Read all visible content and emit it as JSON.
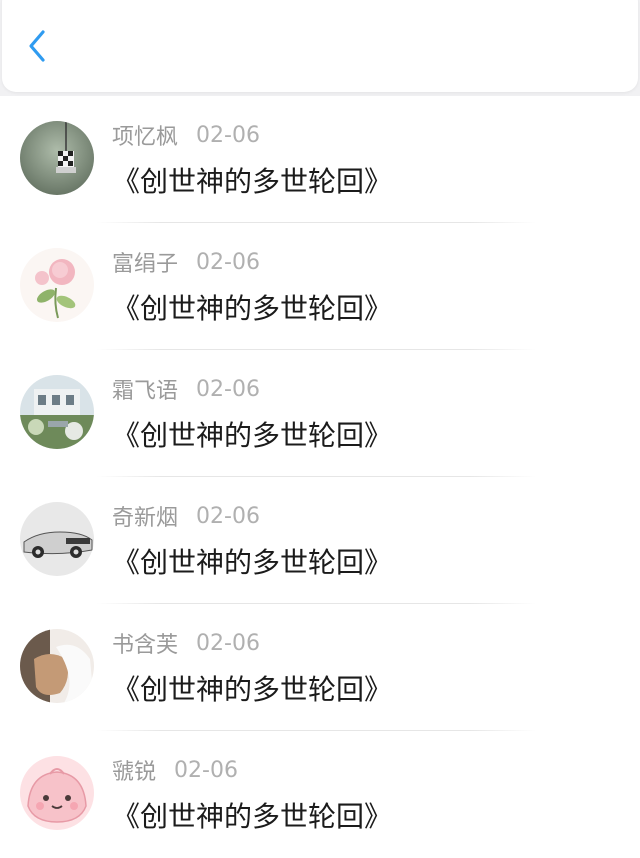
{
  "header": {
    "back_icon": "chevron-left-icon",
    "accent_color": "#2f9bf0"
  },
  "comments": [
    {
      "name": "项忆枫",
      "date": "02-06",
      "title": "《创世神的多世轮回》"
    },
    {
      "name": "富绢子",
      "date": "02-06",
      "title": "《创世神的多世轮回》"
    },
    {
      "name": "霜飞语",
      "date": "02-06",
      "title": "《创世神的多世轮回》"
    },
    {
      "name": "奇新烟",
      "date": "02-06",
      "title": "《创世神的多世轮回》"
    },
    {
      "name": "书含芙",
      "date": "02-06",
      "title": "《创世神的多世轮回》"
    },
    {
      "name": "虢锐",
      "date": "02-06",
      "title": "《创世神的多世轮回》"
    }
  ]
}
